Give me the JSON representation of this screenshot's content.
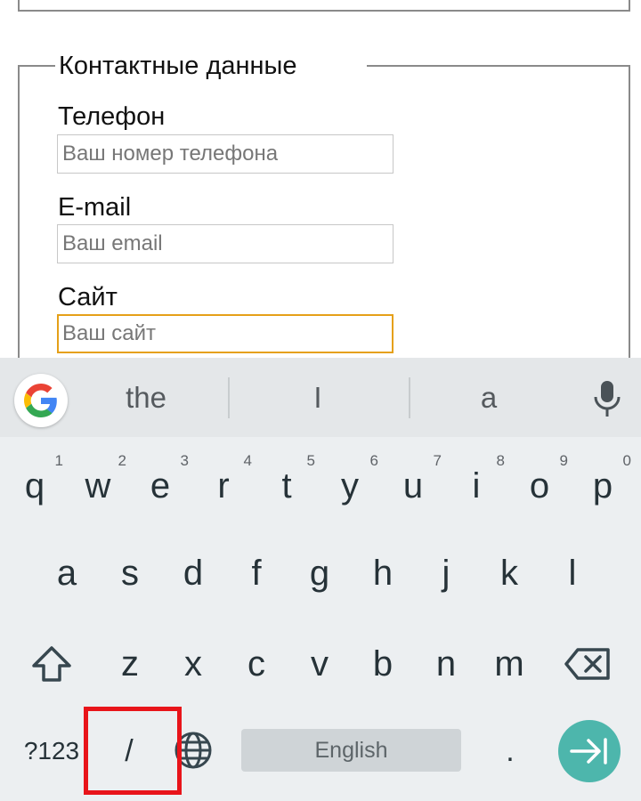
{
  "form": {
    "section_title": "Контактные данные",
    "fields": [
      {
        "label": "Телефон",
        "placeholder": "Ваш номер телефона"
      },
      {
        "label": "E-mail",
        "placeholder": "Ваш email"
      },
      {
        "label": "Сайт",
        "placeholder": "Ваш сайт"
      }
    ]
  },
  "keyboard": {
    "suggestions": [
      "the",
      "I",
      "a"
    ],
    "row1": [
      {
        "letter": "q",
        "hint": "1"
      },
      {
        "letter": "w",
        "hint": "2"
      },
      {
        "letter": "e",
        "hint": "3"
      },
      {
        "letter": "r",
        "hint": "4"
      },
      {
        "letter": "t",
        "hint": "5"
      },
      {
        "letter": "y",
        "hint": "6"
      },
      {
        "letter": "u",
        "hint": "7"
      },
      {
        "letter": "i",
        "hint": "8"
      },
      {
        "letter": "o",
        "hint": "9"
      },
      {
        "letter": "p",
        "hint": "0"
      }
    ],
    "row2": [
      "a",
      "s",
      "d",
      "f",
      "g",
      "h",
      "j",
      "k",
      "l"
    ],
    "row3": [
      "z",
      "x",
      "c",
      "v",
      "b",
      "n",
      "m"
    ],
    "symbols_label": "?123",
    "slash_label": "/",
    "space_label": "English",
    "period_label": ".",
    "icons": {
      "google": "google-icon",
      "mic": "microphone-icon",
      "shift": "shift-icon",
      "backspace": "backspace-icon",
      "globe": "globe-icon",
      "enter": "next-arrow-icon"
    },
    "colors": {
      "highlight": "#e8141a",
      "enter": "#4db6ac",
      "focus_border": "#e5a018"
    }
  }
}
